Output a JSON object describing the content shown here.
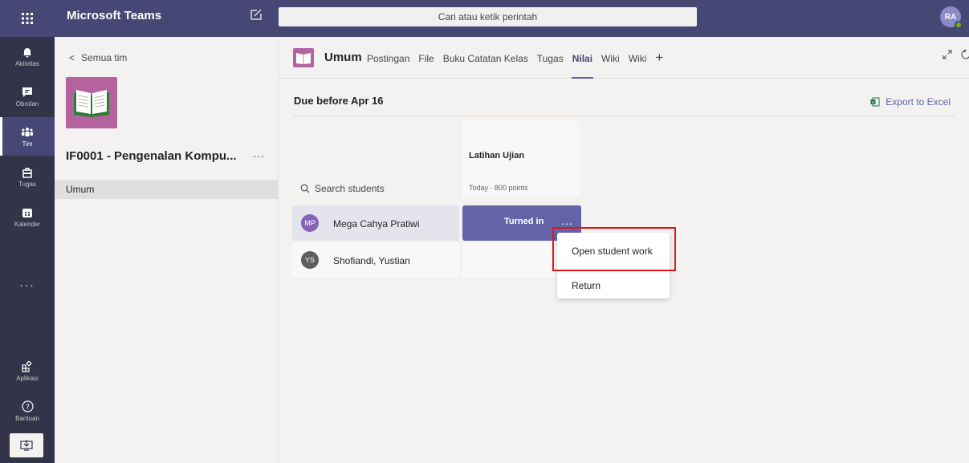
{
  "topbar": {
    "app_title": "Microsoft Teams",
    "search_placeholder": "Cari atau ketik perintah",
    "user_initials": "RA"
  },
  "rail": {
    "items": [
      {
        "label": "Aktivitas",
        "icon": "bell-icon"
      },
      {
        "label": "Obrolan",
        "icon": "chat-icon"
      },
      {
        "label": "Tim",
        "icon": "teams-icon"
      },
      {
        "label": "Tugas",
        "icon": "assignment-icon"
      },
      {
        "label": "Kalender",
        "icon": "calendar-icon"
      }
    ],
    "more": "...",
    "bottom": [
      {
        "label": "Aplikasi",
        "icon": "apps-icon"
      },
      {
        "label": "Bantuan",
        "icon": "help-icon"
      }
    ]
  },
  "team_panel": {
    "back_label": "Semua tim",
    "team_name": "IF0001 - Pengenalan Kompu...",
    "more": "···",
    "channel": "Umum"
  },
  "channel_header": {
    "title": "Umum",
    "tabs": [
      "Postingan",
      "File",
      "Buku Catatan Kelas",
      "Tugas",
      "Nilai",
      "Wiki",
      "Wiki"
    ],
    "active_tab": "Nilai",
    "add": "+"
  },
  "grades": {
    "due_title": "Due before Apr 16",
    "export_label": "Export to Excel",
    "search_placeholder": "Search students",
    "assignment": {
      "name": "Latihan Ujian",
      "meta": "Today · 800 points"
    },
    "students": [
      {
        "initials": "MP",
        "name": "Mega Cahya Pratiwi",
        "color": "#8764b8",
        "status": "Turned in"
      },
      {
        "initials": "YS",
        "name": "Shofiandi, Yustian",
        "color": "#605e5c",
        "status": ""
      }
    ],
    "cell_more": "...",
    "menu": {
      "open": "Open student work",
      "return": "Return"
    }
  },
  "colors": {
    "topbar": "#464775",
    "rail": "#33344a",
    "accent": "#6264a7",
    "highlight": "#e0141b"
  }
}
